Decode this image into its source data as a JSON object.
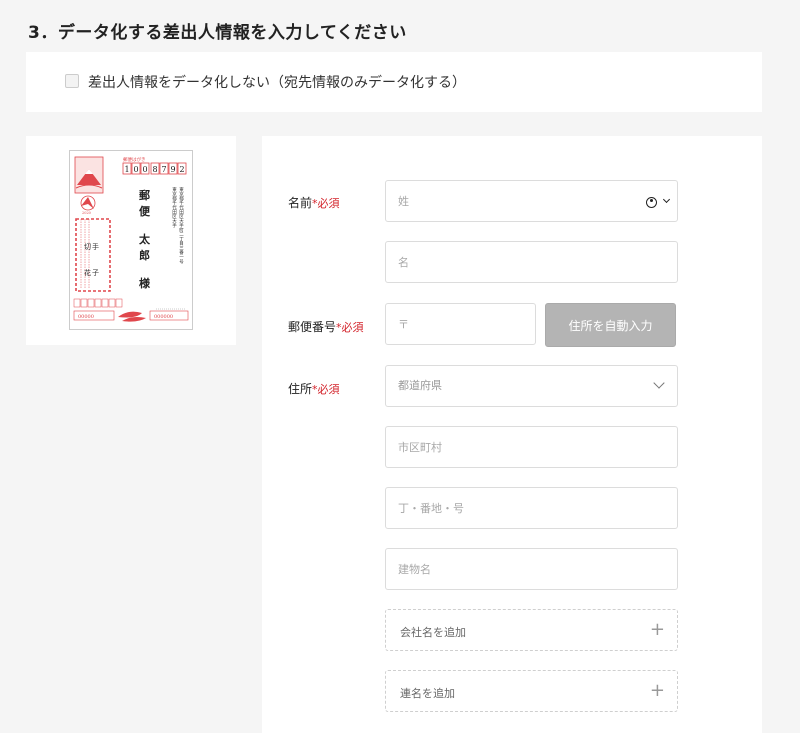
{
  "title": "3．データ化する差出人情報を入力してください",
  "option": {
    "label": "差出人情報をデータ化しない（宛先情報のみデータ化する）"
  },
  "postcard": {
    "postal_code_digits": [
      "1",
      "0",
      "0",
      "8",
      "7",
      "9",
      "2"
    ],
    "recipient_name_lines": [
      "郵",
      "便",
      "太",
      "郎"
    ],
    "honorific": "様",
    "address_text": "東京都千代田区大手町二丁目三番一号",
    "sender_name": "切手 花子",
    "year_label": "2020",
    "left_number": "00000",
    "right_number": "000000"
  },
  "form": {
    "required_mark": "*必須",
    "name_label": "名前",
    "last_name_placeholder": "姓",
    "first_name_placeholder": "名",
    "zip_label": "郵便番号",
    "zip_placeholder": "〒",
    "auto_fill_button": "住所を自動入力",
    "address_label": "住所",
    "prefecture_placeholder": "都道府県",
    "city_placeholder": "市区町村",
    "street_placeholder": "丁・番地・号",
    "building_placeholder": "建物名",
    "add_company": "会社名を追加",
    "add_joint_name": "連名を追加",
    "plus_symbol": "+"
  },
  "colors": {
    "required": "#d3222a",
    "postcard_red": "#e0474c",
    "button_disabled": "#b4b4b4"
  }
}
